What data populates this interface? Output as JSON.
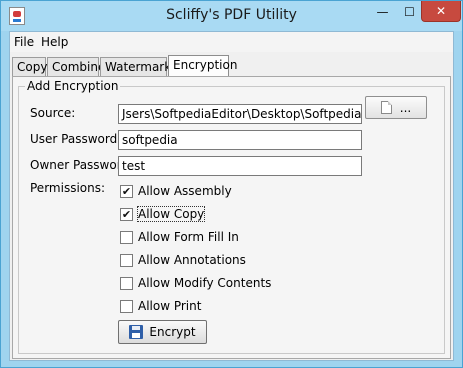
{
  "window": {
    "title": "Scliffy's PDF Utility",
    "minimize_glyph": "—",
    "maximize_glyph": "☐",
    "close_glyph": "✕"
  },
  "menu": [
    {
      "label": "File"
    },
    {
      "label": "Help"
    }
  ],
  "tabs": [
    {
      "label": "Copy",
      "selected": false
    },
    {
      "label": "Combine",
      "selected": false
    },
    {
      "label": "Watermark",
      "selected": false
    },
    {
      "label": "Encryption",
      "selected": true
    }
  ],
  "encryption": {
    "group_title": "Add Encryption",
    "source_label": "Source:",
    "source_value": "Jsers\\SoftpediaEditor\\Desktop\\Softpedia Test.pdf",
    "browse_label": "...",
    "user_password_label": "User Password:",
    "user_password_value": "softpedia",
    "owner_password_label": "Owner Password:",
    "owner_password_value": "test",
    "permissions_label": "Permissions:",
    "permissions": [
      {
        "label": "Allow Assembly",
        "checked": true
      },
      {
        "label": "Allow Copy",
        "checked": true
      },
      {
        "label": "Allow Form Fill In",
        "checked": false
      },
      {
        "label": "Allow Annotations",
        "checked": false
      },
      {
        "label": "Allow Modify Contents",
        "checked": false
      },
      {
        "label": "Allow Print",
        "checked": false
      }
    ],
    "encrypt_label": "Encrypt"
  },
  "icons": {
    "app": "pdf-app-icon",
    "browse": "document-icon",
    "encrypt": "floppy-disk-icon",
    "check": "✔"
  },
  "colors": {
    "titlebar": "#a9daf3",
    "close_button": "#c74a3f",
    "panel": "#f5f5f5"
  }
}
